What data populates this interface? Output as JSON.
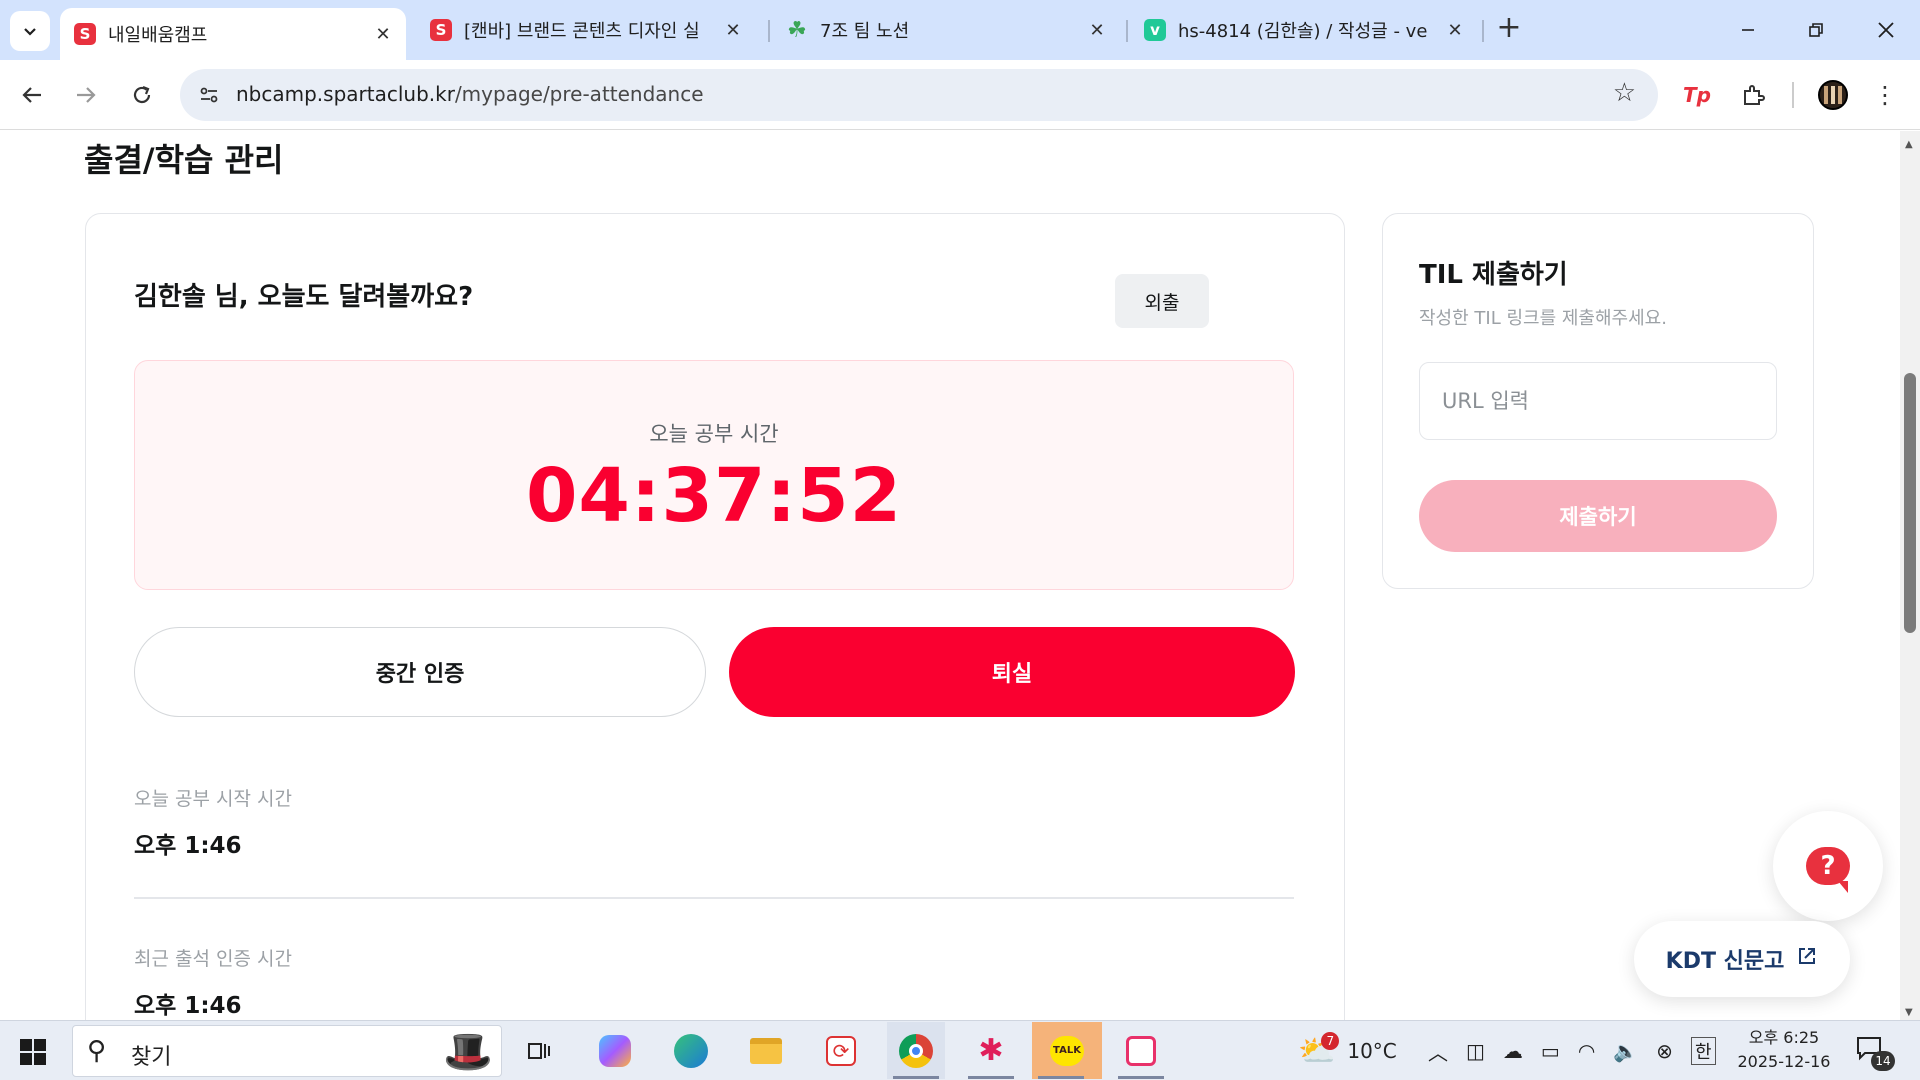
{
  "browser": {
    "tabs": [
      {
        "title": "내일배움캠프",
        "favicon": "sparta-icon",
        "active": true
      },
      {
        "title": "[캔바] 브랜드 콘텐츠 디자인 실",
        "favicon": "sparta-icon",
        "active": false
      },
      {
        "title": "7조 팀 노션",
        "favicon": "clover-icon",
        "active": false
      },
      {
        "title": "hs-4814 (김한솔) / 작성글 - ve",
        "favicon": "velog-icon",
        "active": false
      }
    ],
    "url_domain": "nbcamp.spartaclub.kr",
    "url_path": "/mypage/pre-attendance"
  },
  "page": {
    "title": "출결/학습 관리",
    "greeting": "김한솔 님, 오늘도 달려볼까요?",
    "outing_label": "외출",
    "timer_label": "오늘 공부 시간",
    "timer_value": "04:37:52",
    "checkin_label": "중간 인증",
    "leave_label": "퇴실",
    "start_time_label": "오늘 공부 시작 시간",
    "start_time_value": "오후 1:46",
    "recent_label": "최근 출석 인증 시간",
    "recent_value": "오후 1:46",
    "til": {
      "title": "TIL 제출하기",
      "description": "작성한 TIL 링크를 제출해주세요.",
      "placeholder": "URL 입력",
      "submit_label": "제출하기"
    },
    "help_label": "?",
    "kdt_label": "KDT 신문고"
  },
  "taskbar": {
    "search_placeholder": "찾기",
    "weather_badge": "7",
    "temperature": "10°C",
    "ime": "한",
    "time": "오후 6:25",
    "date": "2025-12-16",
    "notification_count": "14"
  },
  "colors": {
    "accent": "#fa0030",
    "accent_disabled": "#f8b0bd",
    "timer_bg": "#fff6f7",
    "tabstrip_bg": "#d3e3fd"
  }
}
